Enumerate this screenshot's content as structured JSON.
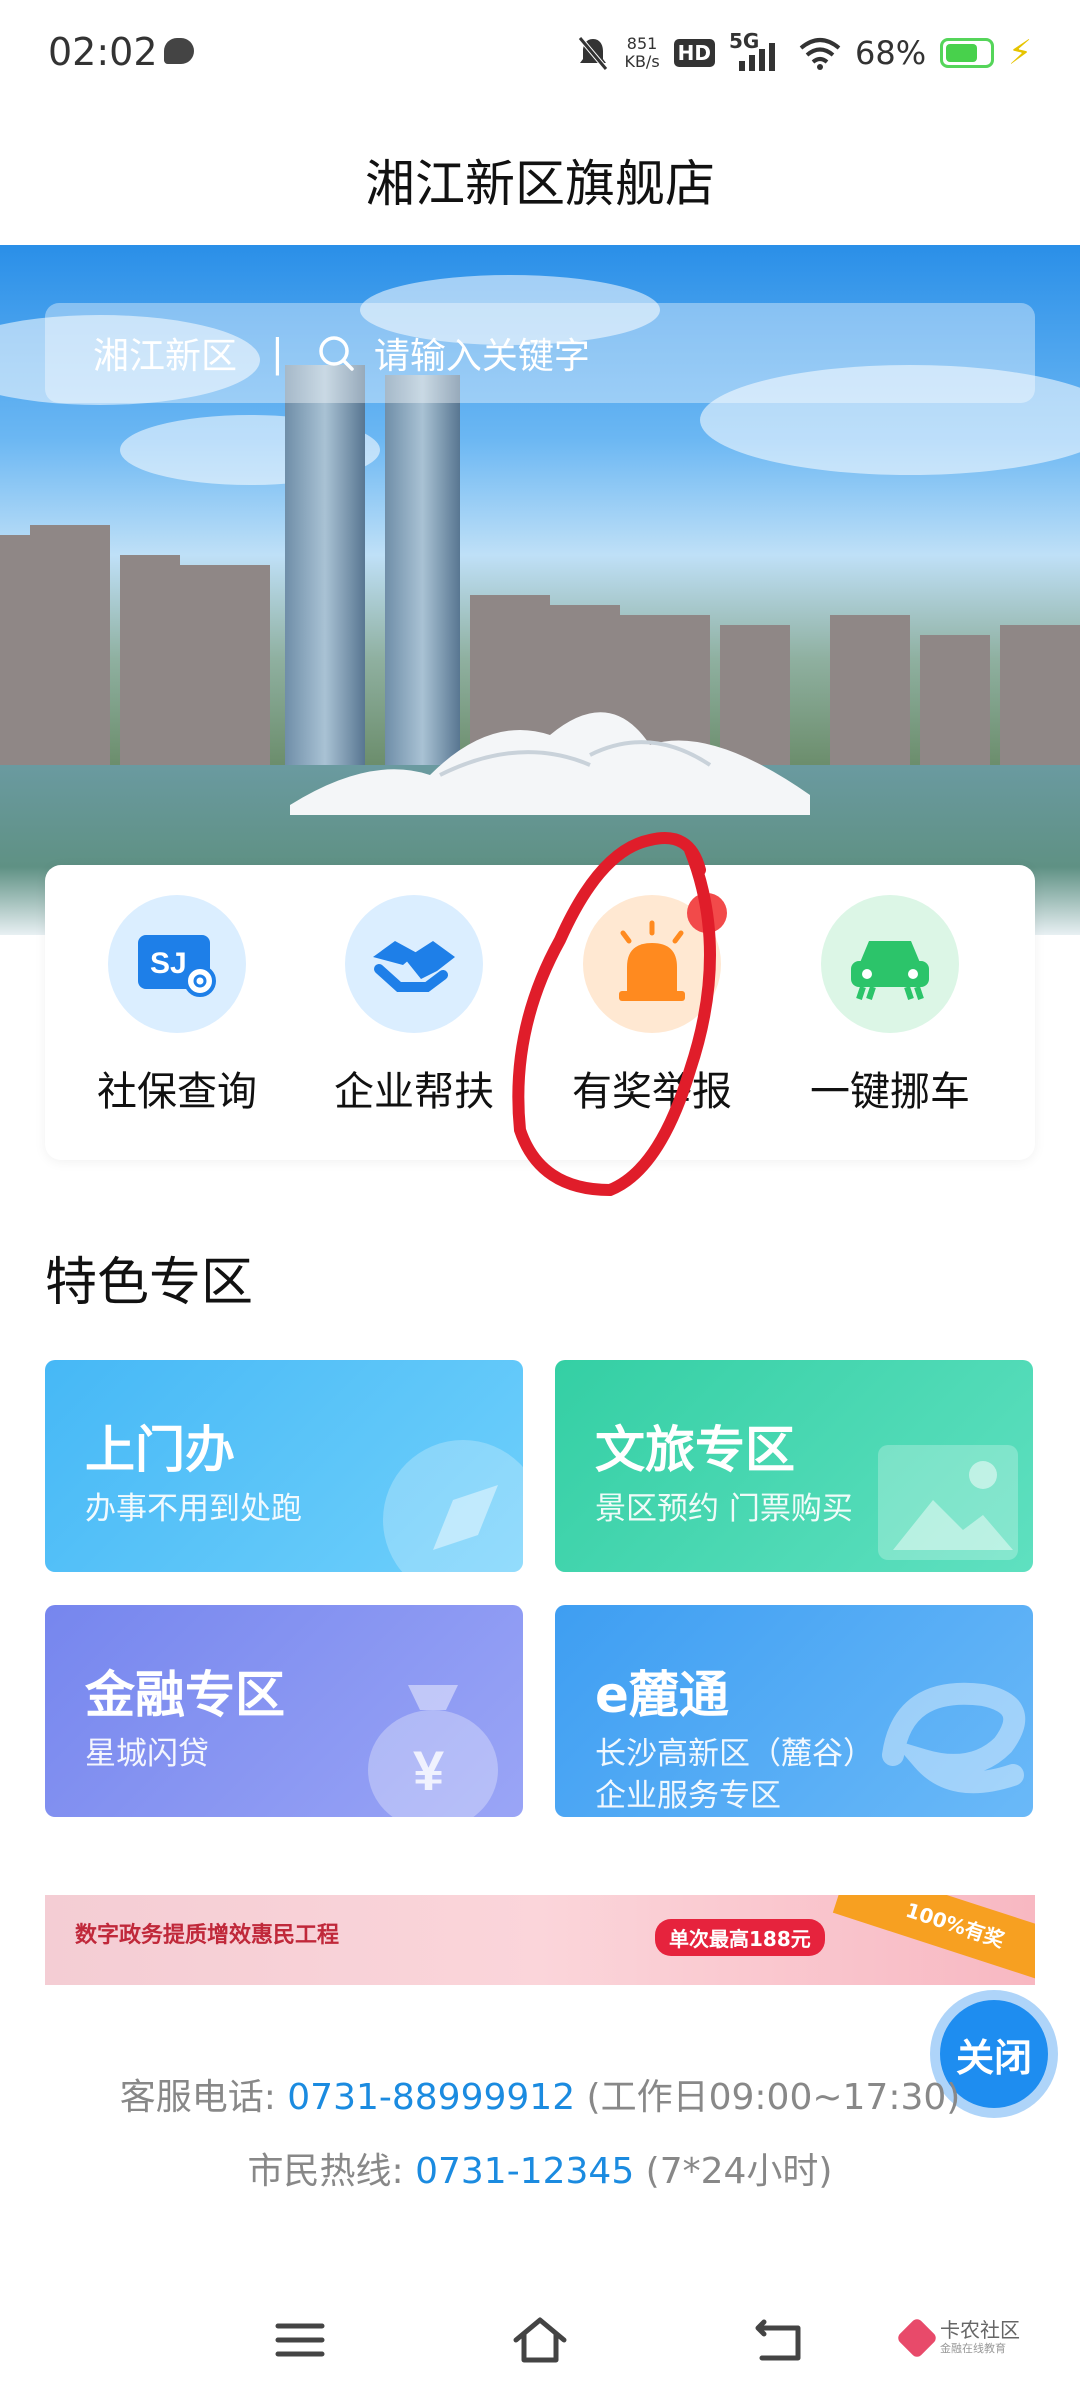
{
  "status_bar": {
    "time": "02:02",
    "net_speed": "851",
    "net_unit": "KB/s",
    "hd": "HD",
    "network": "5G",
    "battery": "68%"
  },
  "header": {
    "title": "湘江新区旗舰店"
  },
  "search": {
    "region": "湘江新区",
    "divider": "|",
    "placeholder": "请输入关键字"
  },
  "quick_actions": [
    {
      "label": "社保查询",
      "icon": "social-security-card-icon",
      "color": "#1e7fe8"
    },
    {
      "label": "企业帮扶",
      "icon": "handshake-icon",
      "color": "#1e7fe8"
    },
    {
      "label": "有奖举报",
      "icon": "alarm-siren-icon",
      "color": "#ff8a1f"
    },
    {
      "label": "一键挪车",
      "icon": "car-icon",
      "color": "#2cc46a"
    }
  ],
  "section": {
    "title": "特色专区"
  },
  "cards": [
    {
      "title": "上门办",
      "subtitle": "办事不用到处跑",
      "color": "#4cbff6",
      "icon": "compass-icon"
    },
    {
      "title": "文旅专区",
      "subtitle": "景区预约 门票购买",
      "color": "#3fd6b0",
      "icon": "picture-icon"
    },
    {
      "title": "金融专区",
      "subtitle": "星城闪贷",
      "color": "#7d8df0",
      "icon": "money-bag-icon"
    },
    {
      "title": "e麓通",
      "subtitle_line1": "长沙高新区（麓谷）",
      "subtitle_line2": "企业服务专区",
      "color": "#4aa8f5",
      "icon": "e-logo-icon"
    }
  ],
  "banner": {
    "text": "数字政务提质增效惠民工程",
    "chip": "单次最高188元",
    "ribbon": "100%有奖"
  },
  "fab": {
    "label": "关闭"
  },
  "contact": {
    "service_label": "客服电话: ",
    "service_number": "0731-88999912",
    "service_hours": " (工作日09:00~17:30)",
    "hotline_label": "市民热线: ",
    "hotline_number": "0731-12345",
    "hotline_hours": " (7*24小时)"
  },
  "watermark": {
    "name": "卡农社区",
    "sub": "金融在线教育"
  },
  "icons": {
    "nav": [
      "menu-icon",
      "home-icon",
      "back-icon"
    ]
  }
}
